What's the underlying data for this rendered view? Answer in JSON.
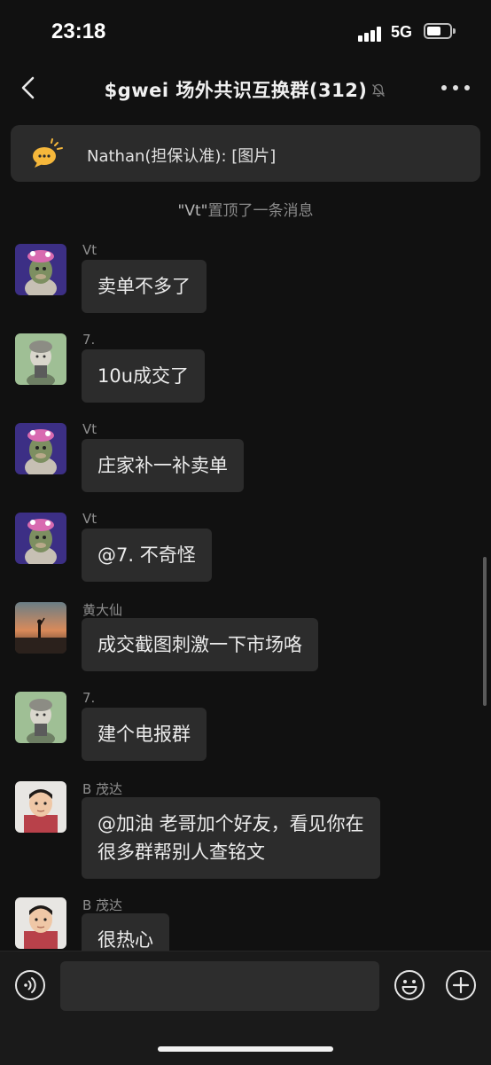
{
  "status": {
    "time": "23:18",
    "network": "5G",
    "icons": [
      "signal-bars-icon",
      "battery-icon"
    ]
  },
  "header": {
    "title": "$gwei 场外共识互换群(312)",
    "back_icon": "chevron-left-icon",
    "mute_icon": "bell-slash-icon",
    "more_icon": "ellipsis-icon"
  },
  "pinned": {
    "icon": "speech-bubble-icon",
    "text": "Nathan(担保认准): [图片]"
  },
  "system_note": {
    "quoted_name": "\"Vt\"",
    "text": "置顶了一条消息"
  },
  "messages": [
    {
      "sender": "Vt",
      "text": "卖单不多了",
      "avatar": "monkey-avatar"
    },
    {
      "sender": "7.",
      "text": "10u成交了",
      "avatar": "kid-avatar"
    },
    {
      "sender": "Vt",
      "text": "庄家补一补卖单",
      "avatar": "monkey-avatar"
    },
    {
      "sender": "Vt",
      "text": "@7. 不奇怪",
      "avatar": "monkey-avatar"
    },
    {
      "sender": "黄大仙",
      "text": "成交截图刺激一下市场咯",
      "avatar": "sunset-avatar"
    },
    {
      "sender": "7.",
      "text": "建个电报群",
      "avatar": "kid-avatar"
    },
    {
      "sender": "B   茂达",
      "text": "@加油 老哥加个好友，看见你在\n很多群帮别人查铭文",
      "avatar": "child-photo-avatar"
    },
    {
      "sender": "B   茂达",
      "text": "很热心",
      "avatar": "child-photo-avatar"
    }
  ],
  "composer": {
    "placeholder": "",
    "voice_icon": "voice-icon",
    "emoji_icon": "emoji-icon",
    "plus_icon": "plus-icon"
  },
  "colors": {
    "background": "#111111",
    "bubble": "#2c2c2c",
    "pinned_bar": "#2b2b2b",
    "pin_icon": "#f5b73b"
  }
}
